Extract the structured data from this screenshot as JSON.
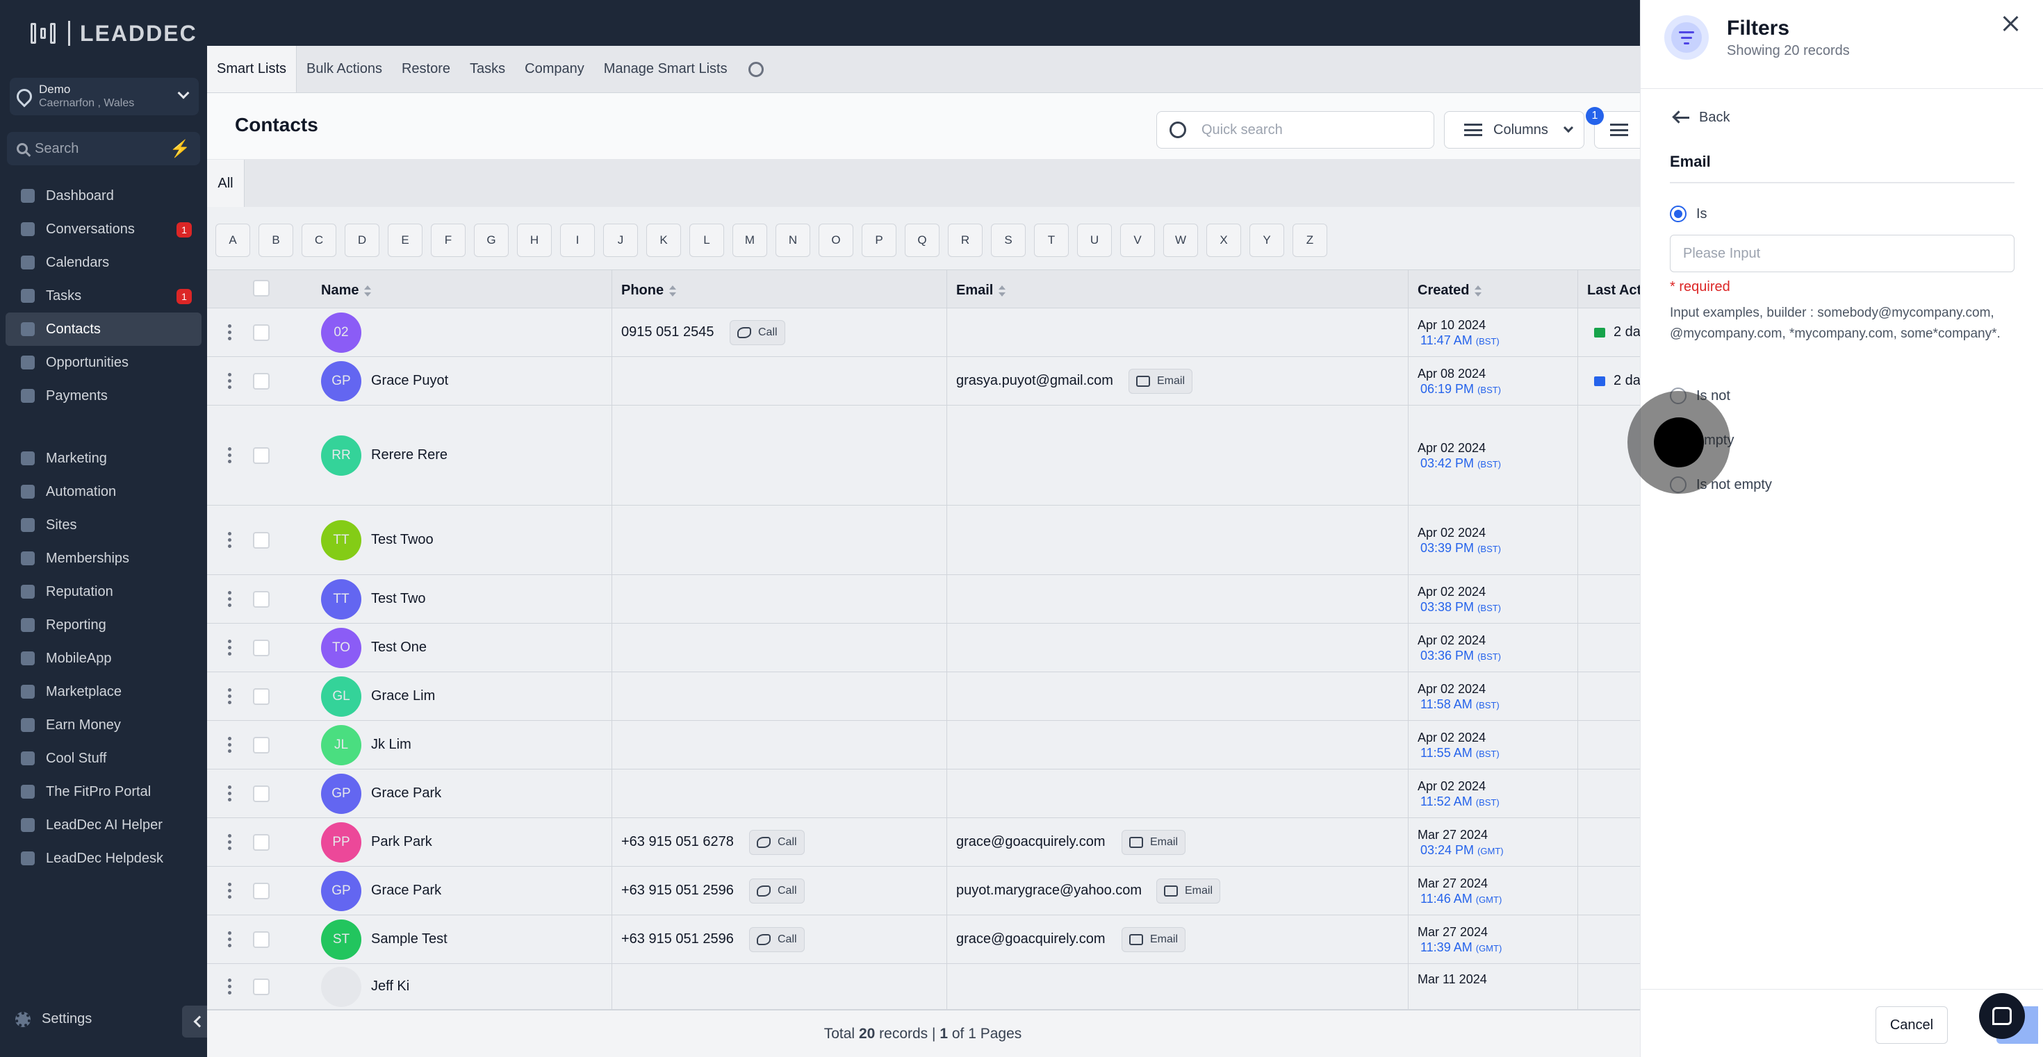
{
  "brand": {
    "logo_text": "LEADDEC"
  },
  "location": {
    "name": "Demo",
    "sub": "Caernarfon , Wales"
  },
  "sidebar": {
    "search_placeholder": "Search",
    "items": [
      {
        "label": "Dashboard",
        "icon": "dashboard-icon"
      },
      {
        "label": "Conversations",
        "icon": "chat-icon",
        "badge": "1"
      },
      {
        "label": "Calendars",
        "icon": "calendar-icon"
      },
      {
        "label": "Tasks",
        "icon": "check-icon",
        "badge": "1"
      },
      {
        "label": "Contacts",
        "icon": "person-icon",
        "active": true
      },
      {
        "label": "Opportunities",
        "icon": "funnel-icon"
      },
      {
        "label": "Payments",
        "icon": "card-icon"
      },
      {
        "label": "Marketing",
        "icon": "megaphone-icon"
      },
      {
        "label": "Automation",
        "icon": "automation-icon"
      },
      {
        "label": "Sites",
        "icon": "sitemap-icon"
      },
      {
        "label": "Memberships",
        "icon": "people-icon"
      },
      {
        "label": "Reputation",
        "icon": "star-icon"
      },
      {
        "label": "Reporting",
        "icon": "chart-icon"
      },
      {
        "label": "MobileApp",
        "icon": "phone-icon"
      },
      {
        "label": "Marketplace",
        "icon": "cart-icon"
      },
      {
        "label": "Earn Money",
        "icon": "money-icon"
      },
      {
        "label": "Cool Stuff",
        "icon": "fire-icon"
      },
      {
        "label": "The FitPro Portal",
        "icon": "dumbbell-icon"
      },
      {
        "label": "LeadDec AI Helper",
        "icon": "robot-icon"
      },
      {
        "label": "LeadDec Helpdesk",
        "icon": "info-icon"
      }
    ],
    "settings_label": "Settings"
  },
  "subnav": {
    "tabs": [
      "Smart Lists",
      "Bulk Actions",
      "Restore",
      "Tasks",
      "Company",
      "Manage Smart Lists"
    ]
  },
  "contacts": {
    "title": "Contacts",
    "quick_search_placeholder": "Quick search",
    "columns_label": "Columns",
    "filter_count": "1",
    "all_tab": "All",
    "letters": [
      "A",
      "B",
      "C",
      "D",
      "E",
      "F",
      "G",
      "H",
      "I",
      "J",
      "K",
      "L",
      "M",
      "N",
      "O",
      "P",
      "Q",
      "R",
      "S",
      "T",
      "U",
      "V",
      "W",
      "X",
      "Y",
      "Z"
    ],
    "headers": {
      "name": "Name",
      "phone": "Phone",
      "email": "Email",
      "created": "Created",
      "last_activity": "Last Acti"
    },
    "call_label": "Call",
    "email_label": "Email",
    "rows": [
      {
        "initials": "02",
        "name": "",
        "phone": "0915 051 2545",
        "email": "",
        "date": "Apr 10 2024",
        "time": "11:47 AM",
        "tz": "(BST)",
        "last": "2 da",
        "avatar_color": "#8b5cf6",
        "last_icon_color": "#16a34a"
      },
      {
        "initials": "GP",
        "name": "Grace Puyot",
        "phone": "",
        "email": "grasya.puyot@gmail.com",
        "date": "Apr 08 2024",
        "time": "06:19 PM",
        "tz": "(BST)",
        "last": "2 da",
        "avatar_color": "#6366f1",
        "last_icon_color": "#2563eb"
      },
      {
        "initials": "RR",
        "name": "Rerere Rere",
        "phone": "",
        "email": "",
        "date": "Apr 02 2024",
        "time": "03:42 PM",
        "tz": "(BST)",
        "last": "",
        "avatar_color": "#34d399"
      },
      {
        "initials": "TT",
        "name": "Test Twoo",
        "phone": "",
        "email": "",
        "date": "Apr 02 2024",
        "time": "03:39 PM",
        "tz": "(BST)",
        "last": "",
        "avatar_color": "#84cc16"
      },
      {
        "initials": "TT",
        "name": "Test Two",
        "phone": "",
        "email": "",
        "date": "Apr 02 2024",
        "time": "03:38 PM",
        "tz": "(BST)",
        "last": "",
        "avatar_color": "#6366f1"
      },
      {
        "initials": "TO",
        "name": "Test One",
        "phone": "",
        "email": "",
        "date": "Apr 02 2024",
        "time": "03:36 PM",
        "tz": "(BST)",
        "last": "",
        "avatar_color": "#8b5cf6"
      },
      {
        "initials": "GL",
        "name": "Grace Lim",
        "phone": "",
        "email": "",
        "date": "Apr 02 2024",
        "time": "11:58 AM",
        "tz": "(BST)",
        "last": "",
        "avatar_color": "#34d399"
      },
      {
        "initials": "JL",
        "name": "Jk Lim",
        "phone": "",
        "email": "",
        "date": "Apr 02 2024",
        "time": "11:55 AM",
        "tz": "(BST)",
        "last": "",
        "avatar_color": "#4ade80"
      },
      {
        "initials": "GP",
        "name": "Grace Park",
        "phone": "",
        "email": "",
        "date": "Apr 02 2024",
        "time": "11:52 AM",
        "tz": "(BST)",
        "last": "",
        "avatar_color": "#6366f1"
      },
      {
        "initials": "PP",
        "name": "Park Park",
        "phone": "+63 915 051 6278",
        "email": "grace@goacquirely.com",
        "date": "Mar 27 2024",
        "time": "03:24 PM",
        "tz": "(GMT)",
        "last": "",
        "avatar_color": "#ec4899"
      },
      {
        "initials": "GP",
        "name": "Grace Park",
        "phone": "+63 915 051 2596",
        "email": "puyot.marygrace@yahoo.com",
        "date": "Mar 27 2024",
        "time": "11:46 AM",
        "tz": "(GMT)",
        "last": "",
        "avatar_color": "#6366f1"
      },
      {
        "initials": "ST",
        "name": "Sample Test",
        "phone": "+63 915 051 2596",
        "email": "grace@goacquirely.com",
        "date": "Mar 27 2024",
        "time": "11:39 AM",
        "tz": "(GMT)",
        "last": "",
        "avatar_color": "#22c55e"
      },
      {
        "initials": "",
        "name": "Jeff Ki",
        "phone": "",
        "email": "",
        "date": "Mar 11 2024",
        "time": "",
        "tz": "",
        "last": "",
        "avatar_color": "#e5e7eb"
      }
    ],
    "footer": {
      "prefix": "Total",
      "total": "20",
      "records_word": "records |",
      "page": "1",
      "of_text": "of 1 Pages"
    }
  },
  "filters": {
    "title": "Filters",
    "subtitle": "Showing 20 records",
    "back_label": "Back",
    "field_label": "Email",
    "options": [
      {
        "label": "Is",
        "selected": true
      },
      {
        "label": "Is not",
        "selected": false
      },
      {
        "label": "empty",
        "selected": false
      },
      {
        "label": "Is not empty",
        "selected": false
      }
    ],
    "input_placeholder": "Please Input",
    "input_value": "",
    "required_text": "* required",
    "examples_text": "Input examples, builder : somebody@mycompany.com, @mycompany.com, *mycompany.com, some*company*.",
    "cancel_label": "Cancel",
    "apply_label": "A"
  }
}
